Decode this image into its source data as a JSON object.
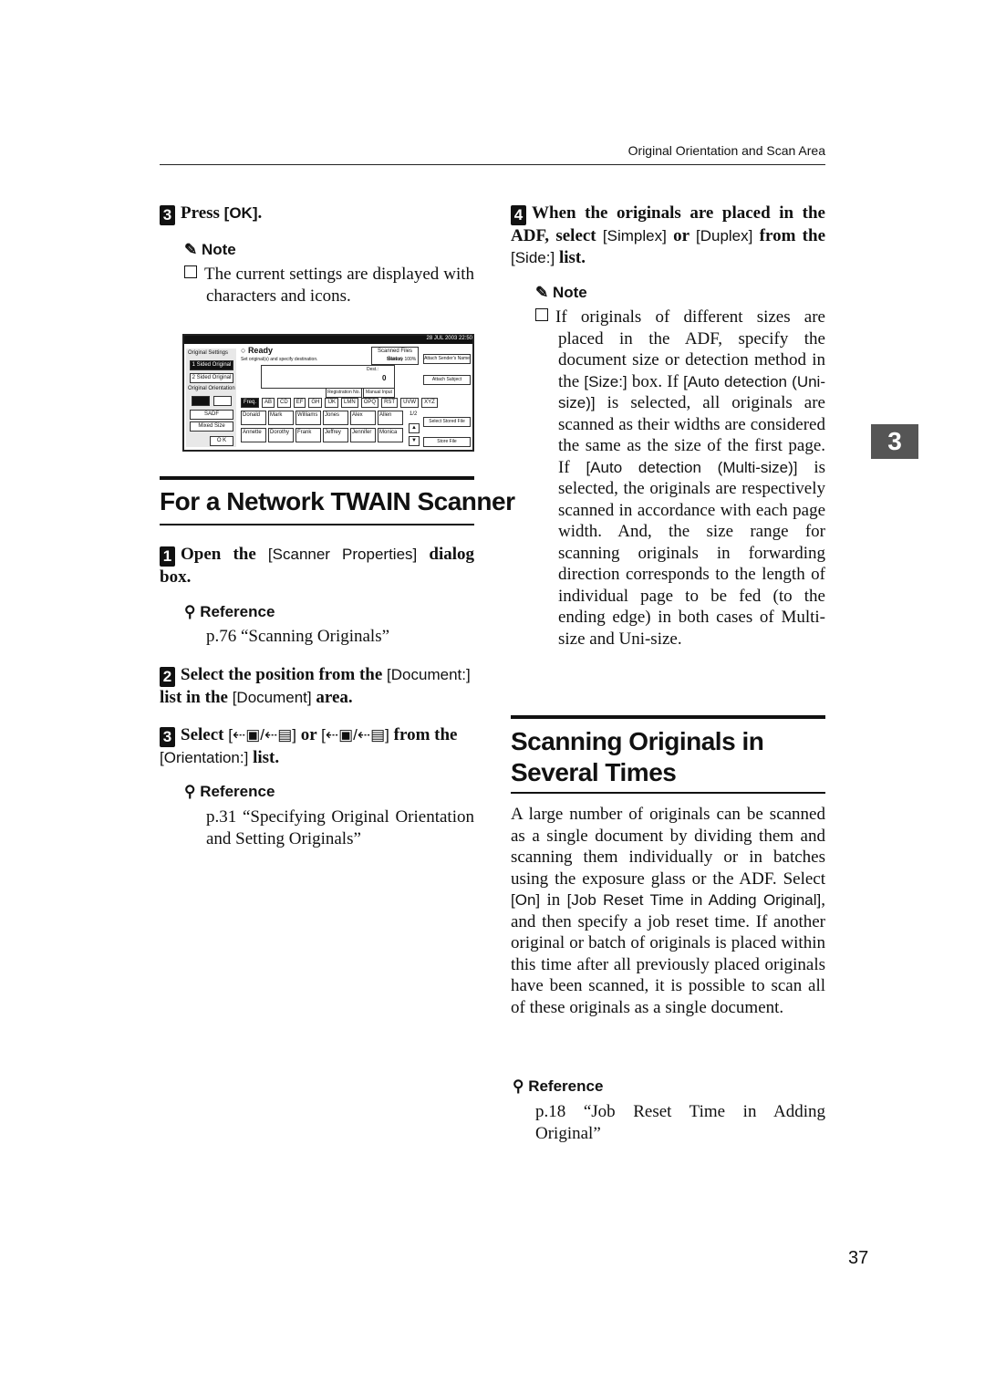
{
  "header": {
    "running_title": "Original Orientation and Scan Area"
  },
  "left": {
    "step_press_ok": {
      "num": "3",
      "pre": "Press ",
      "key": "[OK]",
      "post": "."
    },
    "note1": {
      "label": "Note",
      "text": "The current settings are displayed with characters and icons."
    },
    "screen": {
      "datetime": "28 JUL 2003 22:50",
      "status": "Ready",
      "message": "Set original(s) and specify destination.",
      "memory": "Memory 100%",
      "scanned_files_status": "Scanned Files Status",
      "dest_label": "Dest.:",
      "dest_count": "0",
      "reg_no": "Registration No.",
      "manual_input": "Manual Input",
      "original_settings": "Original Settings",
      "one_sided": "1 Sided Original",
      "two_sided": "2 Sided Original",
      "orientation": "Original Orientation",
      "sadf": "SADF",
      "mixed": "Mixed Size",
      "ok": "O K",
      "tabs": [
        "Freq.",
        "AB",
        "CD",
        "EF",
        "GH",
        "IJK",
        "LMN",
        "OPQ",
        "RST",
        "UVW",
        "XYZ"
      ],
      "names": [
        "Donald",
        "Mark",
        "Williams",
        "Jones",
        "Alex",
        "Allen",
        "Annette",
        "Dorothy",
        "Frank",
        "Jeffrey",
        "Jennifer",
        "Monica"
      ],
      "page": "1/2",
      "attach_sender": "Attach Sender's Name",
      "attach_subject": "Attach Subject",
      "select_stored": "Select Stored File",
      "store_file": "Store File"
    },
    "section_title": "For a Network TWAIN Scanner",
    "step1": {
      "num": "1",
      "pre": "Open the ",
      "key": "[Scanner Properties]",
      "post": " dialog box."
    },
    "ref1": {
      "label": "Reference",
      "text": "p.76 “Scanning Originals”"
    },
    "step2": {
      "num": "2",
      "pre": "Select the position from the ",
      "key1": "[Document:]",
      "mid": " list in the ",
      "key2": "[Document]",
      "post": " area."
    },
    "step3": {
      "num": "3",
      "pre": "Select ",
      "mid": " or ",
      "post": " from the ",
      "key": "[Orientation:]",
      "post2": " list."
    },
    "ref2": {
      "label": "Reference",
      "text": "p.31 “Specifying Original Orientation and Setting Originals”"
    }
  },
  "right": {
    "step4": {
      "num": "4",
      "pre": "When the originals are placed in the ADF, select ",
      "key1": "[Simplex]",
      "mid": " or ",
      "key2": "[Duplex]",
      "mid2": " from the ",
      "key3": "[Side:]",
      "post": " list."
    },
    "note2": {
      "label": "Note",
      "t1": "If originals of different sizes are placed in the ADF, specify the document size or detection method in the ",
      "k1": "[Size:]",
      "t2": " box. If ",
      "k2": "[Auto detection (Uni-size)]",
      "t3": " is selected, all originals are scanned as their widths are considered the same as the size of the first page. If ",
      "k3": "[Auto detection (Multi-size)]",
      "t4": " is selected, the originals are respectively scanned in accordance with each page width. And, the size range for scanning originals in forwarding direction corresponds to the length of individual page to be fed (to the ending edge) in both cases of Multi-size and Uni-size."
    },
    "section_title": "Scanning Originals in Several Times",
    "para": {
      "t1": "A large number of originals can be scanned as a single document by dividing them and scanning them individually or in batches using the exposure glass or the ADF. Select ",
      "k1": "[On]",
      "t2": " in ",
      "k2": "[Job Reset Time in Adding Original]",
      "t3": ", and then specify a job reset time. If another original or batch of originals is placed within this time after all previously placed originals have been scanned, it is possible to scan all of these originals as a single document."
    },
    "ref3": {
      "label": "Reference",
      "text": "p.18 “Job Reset Time in Adding Original”"
    }
  },
  "chapter_tab": "3",
  "page_number": "37"
}
